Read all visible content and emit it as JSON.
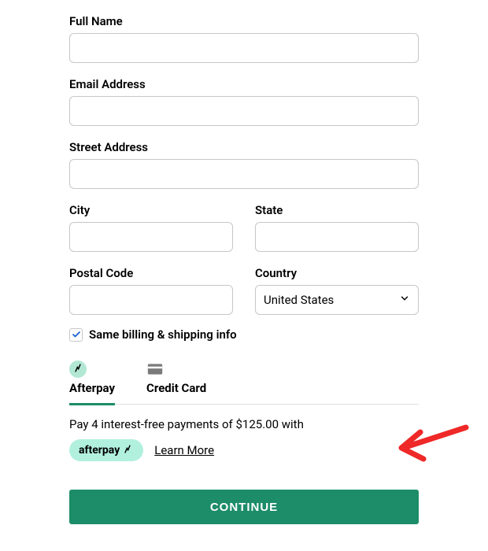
{
  "form": {
    "full_name": {
      "label": "Full Name",
      "value": ""
    },
    "email": {
      "label": "Email Address",
      "value": ""
    },
    "street": {
      "label": "Street Address",
      "value": ""
    },
    "city": {
      "label": "City",
      "value": ""
    },
    "state": {
      "label": "State",
      "value": ""
    },
    "postal": {
      "label": "Postal Code",
      "value": ""
    },
    "country": {
      "label": "Country",
      "value": "United States"
    },
    "same_billing": {
      "label": "Same billing & shipping info",
      "checked": true
    }
  },
  "tabs": {
    "afterpay": "Afterpay",
    "creditcard": "Credit Card",
    "active": "afterpay"
  },
  "afterpay": {
    "message": "Pay 4 interest-free payments of $125.00 with",
    "badge_text": "afterpay",
    "learn_more": "Learn More",
    "installments": 4,
    "installment_amount": "$125.00"
  },
  "actions": {
    "continue": "CONTINUE"
  },
  "colors": {
    "accent": "#1d8c68",
    "afterpay_badge": "#b2f0de",
    "annotation": "#ef2828"
  }
}
